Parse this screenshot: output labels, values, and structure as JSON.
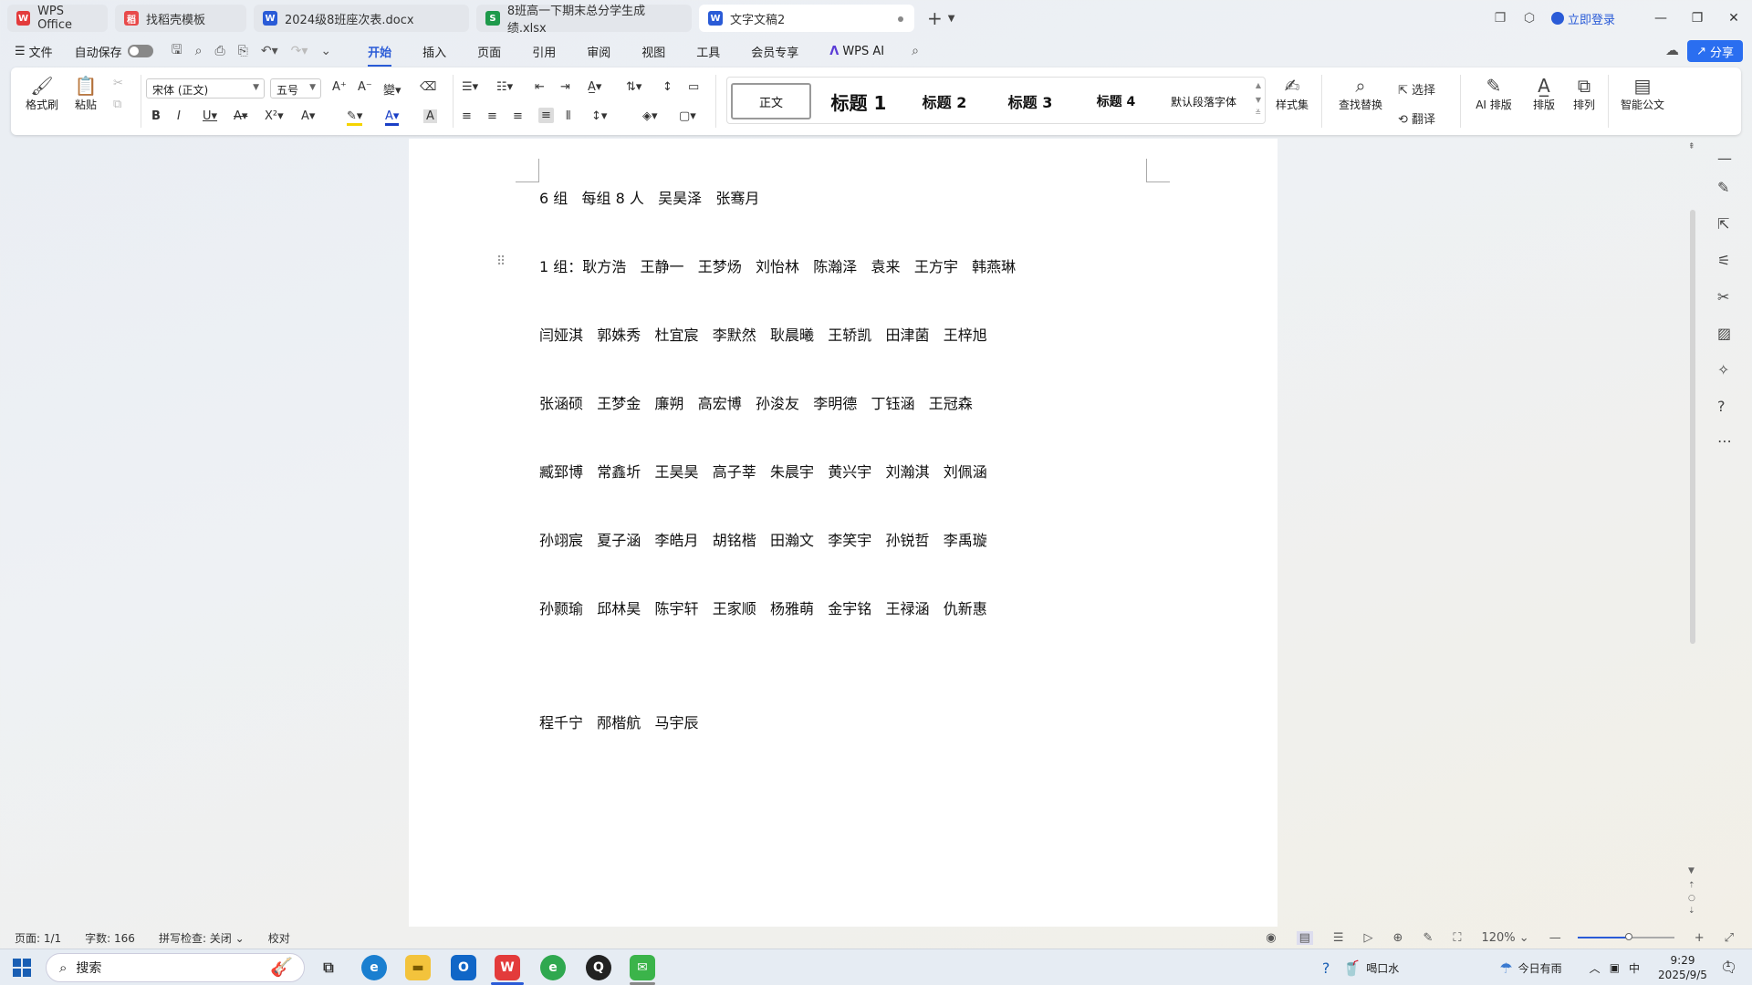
{
  "tabs": [
    {
      "label": "WPS Office",
      "icon": "wps-logo-icon",
      "color": "#e33b3b"
    },
    {
      "label": "找稻壳模板",
      "icon": "docer-icon",
      "color": "#e84a4a"
    },
    {
      "label": "2024级8班座次表.docx",
      "icon": "word-doc-icon",
      "color": "#2a5bd7"
    },
    {
      "label": "8班高一下期末总分学生成绩.xlsx",
      "icon": "sheet-icon",
      "color": "#1e9a4b"
    },
    {
      "label": "文字文稿2",
      "icon": "word-doc-icon",
      "color": "#2a5bd7"
    }
  ],
  "window": {
    "login": "立即登录"
  },
  "menu": {
    "file": "文件",
    "autosave": "自动保存",
    "tabs": [
      "开始",
      "插入",
      "页面",
      "引用",
      "审阅",
      "视图",
      "工具",
      "会员专享"
    ],
    "ai": "WPS AI",
    "share": "分享"
  },
  "ribbon": {
    "format_painter": "格式刷",
    "paste": "粘贴",
    "font_name": "宋体 (正文)",
    "font_size": "五号",
    "styles": [
      "正文",
      "标题 1",
      "标题 2",
      "标题 3",
      "标题 4",
      "默认段落字体"
    ],
    "style_set": "样式集",
    "find_replace": "查找替换",
    "select": "选择",
    "translate": "翻译",
    "ai_layout": "AI 排版",
    "layout": "排版",
    "arrange": "排列",
    "smart_doc": "智能公文"
  },
  "document": {
    "lines": [
      "6 组   每组 8 人   吴昊泽   张骞月",
      "1 组：耿方浩   王静一   王梦炀   刘怡林   陈瀚泽   袁来   王方宇   韩燕琳",
      "闫娅淇   郭姝秀   杜宜宸   李默然   耿晨曦   王轿凯   田津菌   王梓旭",
      "张涵硕   王梦金   廉朔   高宏博   孙浚友   李明德   丁钰涵   王冠森",
      "臧郅博   常鑫圻   王昊昊   高子莘   朱晨宇   黄兴宇   刘瀚淇   刘佩涵",
      "孙翊宸   夏子涵   李皓月   胡铭楷   田瀚文   李笑宇   孙锐哲   李禹璇",
      "孙颢瑜   邱林昊   陈宇轩   王家顺   杨雅萌   金宇铭   王禄涵   仇新惠",
      "程千宁   邴楷航   马宇辰"
    ]
  },
  "status": {
    "page": "页面: 1/1",
    "words": "字数: 166",
    "spell": "拼写检查: 关闭",
    "proof": "校对",
    "zoom": "120%",
    "zoom_fraction": 0.5
  },
  "taskbar": {
    "search": "搜索",
    "weather1": "喝口水",
    "weather2": "今日有雨",
    "ime": "中",
    "time": "9:29",
    "date": "2025/9/5",
    "notif": "1"
  },
  "colors": {
    "accent": "#2a5bd7",
    "share_bg": "#2a6ef0"
  }
}
